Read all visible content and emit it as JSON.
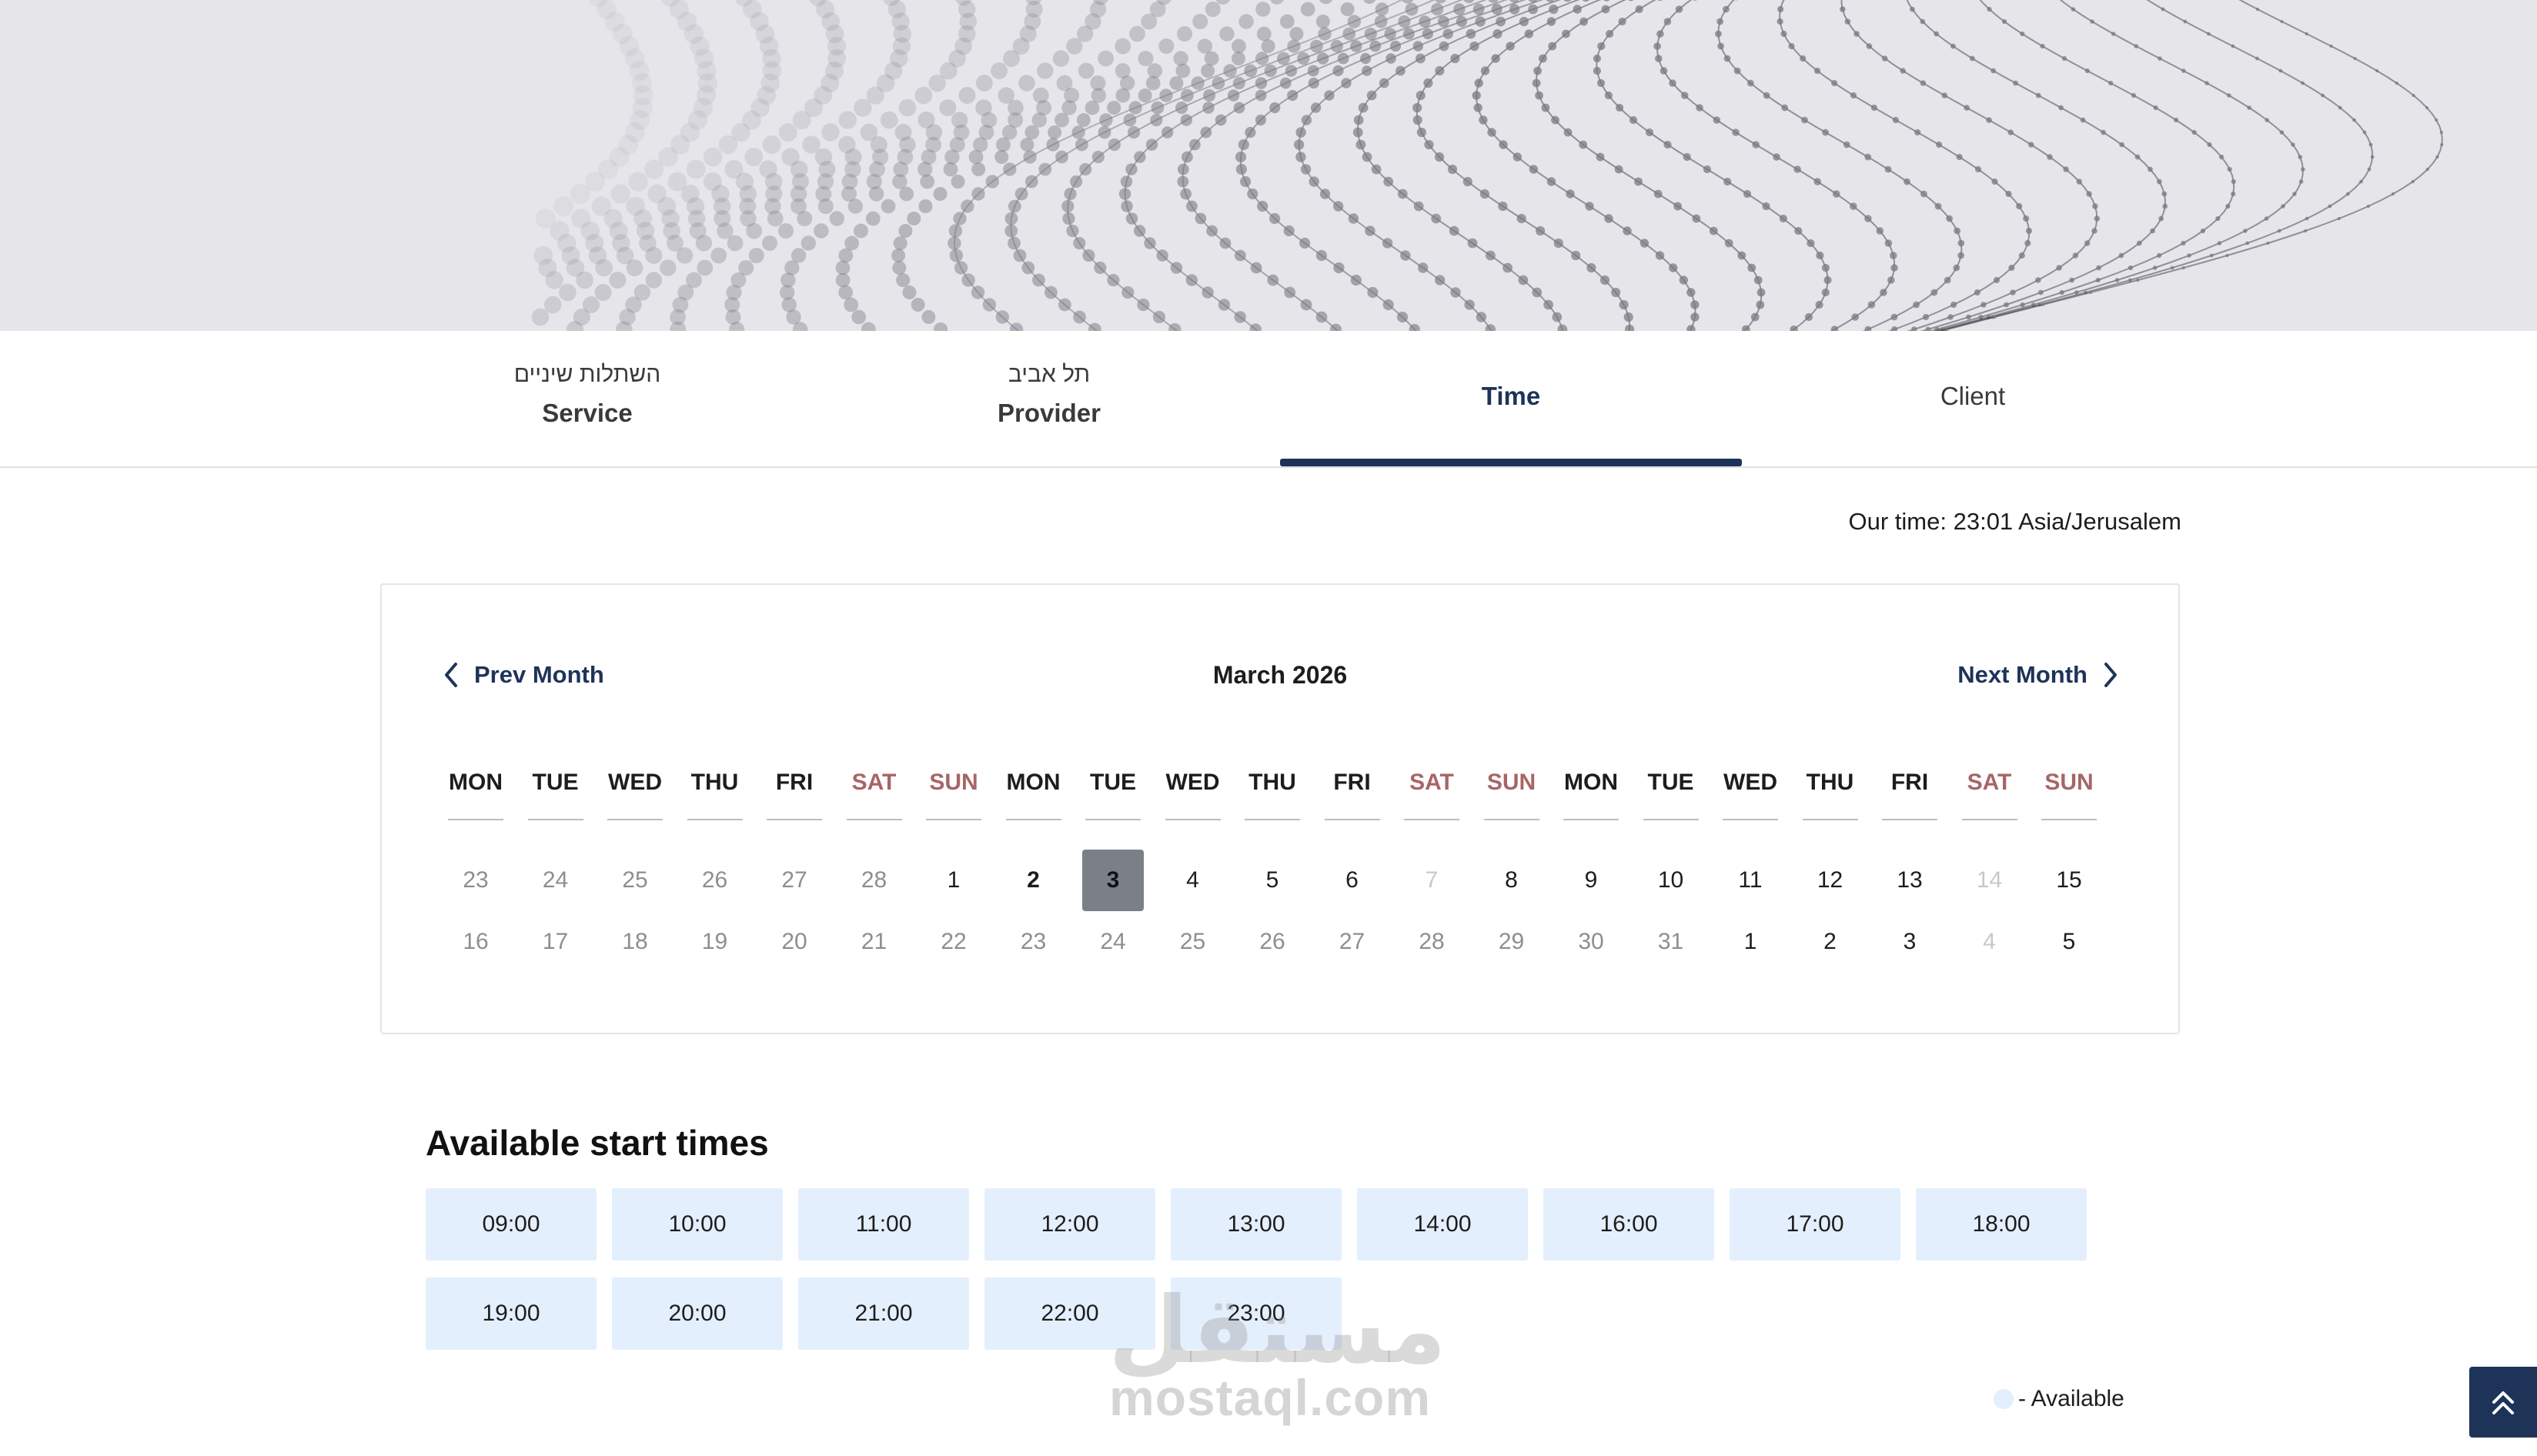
{
  "steps": [
    {
      "sub": "השתלות שיניים",
      "name": "Service"
    },
    {
      "sub": "תל אביב",
      "name": "Provider"
    },
    {
      "sub": "",
      "name": "Time"
    },
    {
      "sub": "",
      "name": "Client"
    }
  ],
  "our_time": "Our time: 23:01 Asia/Jerusalem",
  "calendar": {
    "prev_label": "Prev Month",
    "next_label": "Next Month",
    "month_title": "March 2026",
    "weekdays": [
      "MON",
      "TUE",
      "WED",
      "THU",
      "FRI",
      "SAT",
      "SUN",
      "MON",
      "TUE",
      "WED",
      "THU",
      "FRI",
      "SAT",
      "SUN",
      "MON",
      "TUE",
      "WED",
      "THU",
      "FRI",
      "SAT",
      "SUN"
    ],
    "weeks": [
      [
        "23",
        "24",
        "25",
        "26",
        "27",
        "28",
        "1",
        "2",
        "3",
        "4",
        "5",
        "6",
        "7",
        "8",
        "9",
        "10",
        "11",
        "12",
        "13",
        "14",
        "15"
      ],
      [
        "16",
        "17",
        "18",
        "19",
        "20",
        "21",
        "22",
        "23",
        "24",
        "25",
        "26",
        "27",
        "28",
        "29",
        "30",
        "31",
        "1",
        "2",
        "3",
        "4",
        "5"
      ]
    ],
    "today": "2",
    "selected": "3"
  },
  "available": {
    "title": "Available start times",
    "slots": [
      "09:00",
      "10:00",
      "11:00",
      "12:00",
      "13:00",
      "14:00",
      "16:00",
      "17:00",
      "18:00",
      "19:00",
      "20:00",
      "21:00",
      "22:00",
      "23:00"
    ]
  },
  "legend": {
    "label": "- Available"
  },
  "watermark": {
    "arabic": "مستقل",
    "latin": "mostaql.com"
  },
  "icons": {
    "prev": "chevron-left-icon",
    "next": "chevron-right-icon",
    "scroll_top": "double-chevron-up-icon"
  },
  "colors": {
    "accent": "#1e3358",
    "slot_bg": "#e4effd",
    "weekend": "#a86565",
    "selected_day": "#7a7f88",
    "hero_bg": "#e6e5ea"
  }
}
